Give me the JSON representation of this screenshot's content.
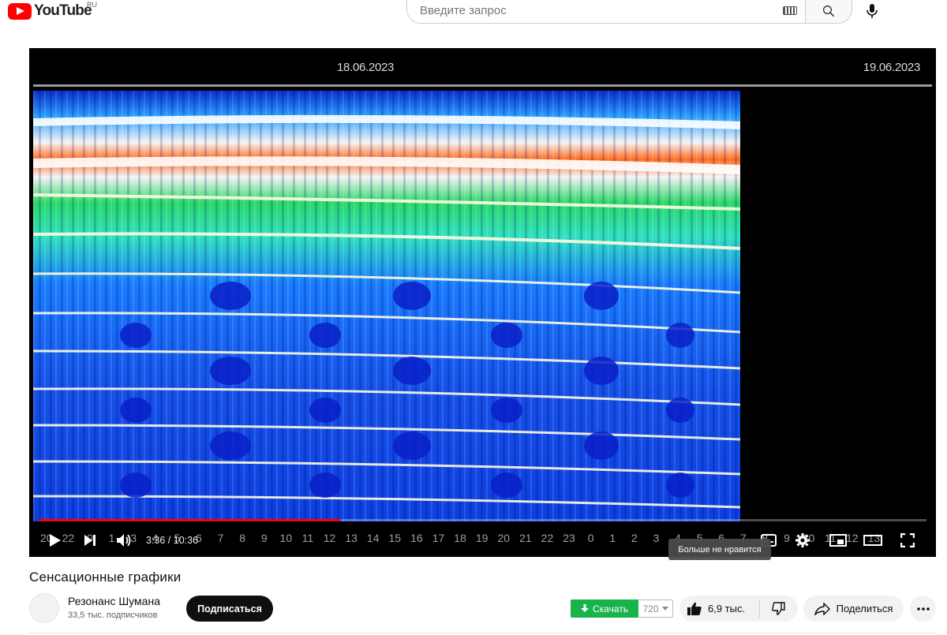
{
  "header": {
    "logo_text": "YouTube",
    "region": "RU",
    "search_placeholder": "Введите запрос"
  },
  "player": {
    "date_left": "18.06.2023",
    "date_right": "19.06.2023",
    "time_display": "3:36 / 10:36",
    "progress": 0.34,
    "hour_ticks": [
      "20",
      "22",
      "0",
      "1",
      "3",
      "4",
      "5",
      "6",
      "7",
      "8",
      "9",
      "10",
      "11",
      "12",
      "13",
      "14",
      "15",
      "16",
      "17",
      "18",
      "19",
      "20",
      "21",
      "22",
      "23",
      "0",
      "1",
      "2",
      "3",
      "4",
      "5",
      "6",
      "7",
      "8",
      "9",
      "10",
      "11",
      "12",
      "13"
    ],
    "tooltip": "Больше не нравится"
  },
  "video": {
    "title": "Сенсационные графики",
    "channel_name": "Резонанс Шумана",
    "subscribers": "33,5 тыс. подписчиков",
    "subscribe_label": "Подписаться",
    "download_label": "Скачать",
    "download_quality": "720",
    "likes": "6,9 тыс.",
    "share_label": "Поделиться"
  },
  "colors": {
    "brand_red": "#ff0000",
    "download_green": "#18b34a",
    "progress_red": "#ff0000"
  }
}
